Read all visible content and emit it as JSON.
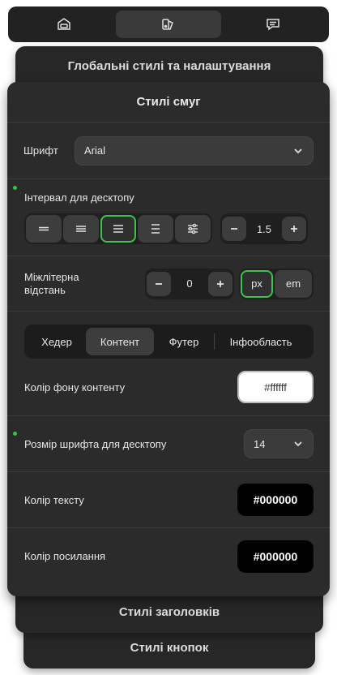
{
  "panels": {
    "global_title": "Глобальні стилі та налаштування",
    "main_title": "Стилі смуг",
    "headings_title": "Стилі заголовків",
    "buttons_title": "Стилі кнопок"
  },
  "font": {
    "label": "Шрифт",
    "value": "Arial"
  },
  "interval": {
    "label": "Інтервал для десктопу",
    "value": "1.5",
    "alignment_options": [
      "align-lines-1",
      "align-lines-2",
      "align-lines-3",
      "align-lines-4",
      "settings"
    ],
    "active_index": 2
  },
  "letter_spacing": {
    "label_line1": "Міжлітерна",
    "label_line2": "відстань",
    "value": "0",
    "units": [
      "px",
      "em"
    ],
    "active_unit": "px"
  },
  "tabs": {
    "items": [
      "Хедер",
      "Контент",
      "Футер",
      "Інфообласть"
    ],
    "active": "Контент"
  },
  "content_bg": {
    "label": "Колір фону контенту",
    "value": "#ffffff"
  },
  "font_size": {
    "label": "Розмір шрифта для десктопу",
    "value": "14"
  },
  "text_color": {
    "label": "Колір тексту",
    "value": "#000000"
  },
  "link_color": {
    "label": "Колір посилання",
    "value": "#000000"
  },
  "colors": {
    "accent": "#3ec24e",
    "panel": "#2b2b2b"
  }
}
